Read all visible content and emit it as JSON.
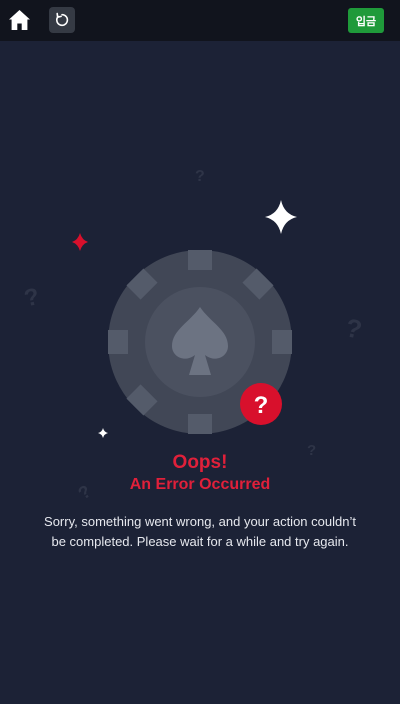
{
  "header": {
    "home_icon": "home-icon",
    "refresh_icon": "refresh-icon",
    "deposit_label": "입금",
    "deposit_color": "#1f9a3a"
  },
  "error": {
    "title": "Oops!",
    "subtitle": "An Error Occurred",
    "message": "Sorry, something went wrong, and your action couldn’t be completed. Please wait for a while and try again.",
    "accent_color": "#e0203a",
    "chip_icon": "poker-chip-spade-icon",
    "badge_icon": "question-badge-icon"
  }
}
